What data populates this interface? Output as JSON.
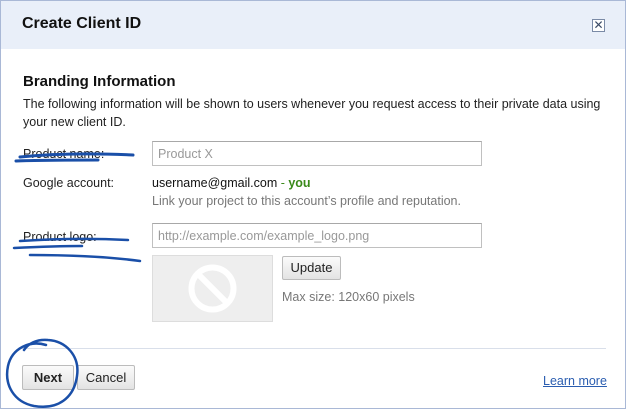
{
  "dialog": {
    "title": "Create Client ID",
    "close_icon": "close-icon",
    "close_glyph": "✕"
  },
  "branding": {
    "heading": "Branding Information",
    "description": "The following information will be shown to users whenever you request access to their private data using your new client ID."
  },
  "product_name": {
    "label": "Product name:",
    "placeholder": "Product X",
    "value": ""
  },
  "google_account": {
    "label": "Google account:",
    "email": "username@gmail.com",
    "dash": " - ",
    "you": "you",
    "hint": "Link your project to this account’s profile and reputation."
  },
  "product_logo": {
    "label": "Product logo:",
    "placeholder": "http://example.com/example_logo.png",
    "value": "",
    "preview_icon": "no-image-icon",
    "update_label": "Update",
    "max_size": "Max size: 120x60 pixels"
  },
  "footer": {
    "next_label": "Next",
    "cancel_label": "Cancel",
    "learn_more": "Learn more"
  },
  "annotation_color": "#1a4fa8"
}
